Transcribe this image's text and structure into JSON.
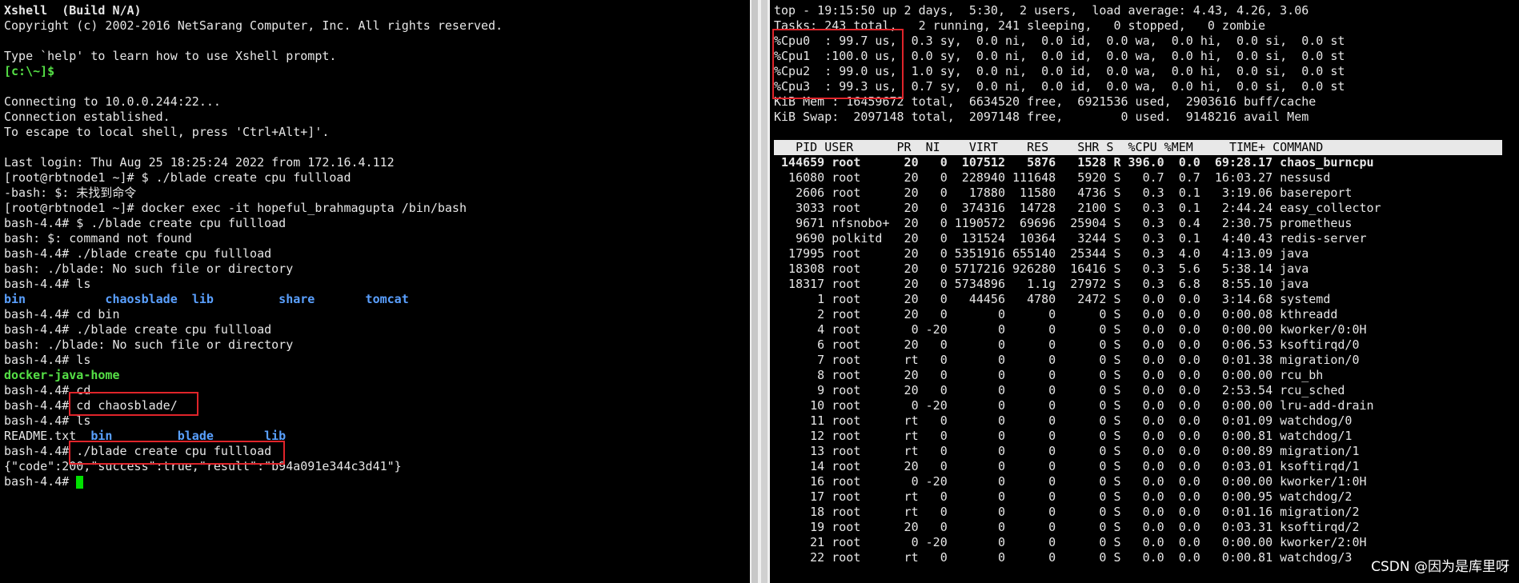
{
  "left_terminal": {
    "lines": [
      {
        "text": "Xshell  (Build N/A)",
        "style": "bold"
      },
      {
        "text": "Copyright (c) 2002-2016 NetSarang Computer, Inc. All rights reserved.",
        "style": ""
      },
      {
        "text": "",
        "style": ""
      },
      {
        "text": "Type `help' to learn how to use Xshell prompt.",
        "style": ""
      },
      {
        "text": "[c:\\~]$",
        "style": "green"
      },
      {
        "text": "",
        "style": ""
      },
      {
        "text": "Connecting to 10.0.0.244:22...",
        "style": ""
      },
      {
        "text": "Connection established.",
        "style": ""
      },
      {
        "text": "To escape to local shell, press 'Ctrl+Alt+]'.",
        "style": ""
      },
      {
        "text": "",
        "style": ""
      },
      {
        "text": "Last login: Thu Aug 25 18:25:24 2022 from 172.16.4.112",
        "style": ""
      },
      {
        "text": "[root@rbtnode1 ~]# $ ./blade create cpu fullload",
        "style": ""
      },
      {
        "text": "-bash: $: 未找到命令",
        "style": ""
      },
      {
        "text": "[root@rbtnode1 ~]# docker exec -it hopeful_brahmagupta /bin/bash",
        "style": ""
      },
      {
        "text": "bash-4.4# $ ./blade create cpu fullload",
        "style": ""
      },
      {
        "text": "bash: $: command not found",
        "style": ""
      },
      {
        "text": "bash-4.4# ./blade create cpu fullload",
        "style": ""
      },
      {
        "text": "bash: ./blade: No such file or directory",
        "style": ""
      },
      {
        "text": "bash-4.4# ls",
        "style": ""
      },
      {
        "text": "bin           chaosblade  lib         share       tomcat",
        "style": "blue"
      },
      {
        "text": "bash-4.4# cd bin",
        "style": ""
      },
      {
        "text": "bash-4.4# ./blade create cpu fullload",
        "style": ""
      },
      {
        "text": "bash: ./blade: No such file or directory",
        "style": ""
      },
      {
        "text": "bash-4.4# ls",
        "style": ""
      },
      {
        "text": "docker-java-home",
        "style": "green"
      },
      {
        "text": "bash-4.4# cd",
        "style": ""
      },
      {
        "text": "bash-4.4# cd chaosblade/",
        "style": ""
      },
      {
        "text": "bash-4.4# ls",
        "style": ""
      },
      {
        "text": "README.txt  bin         blade       lib",
        "style": "mixed"
      },
      {
        "text": "bash-4.4# ./blade create cpu fullload",
        "style": ""
      },
      {
        "text": "{\"code\":200,\"success\":true,\"result\":\"b94a091e344c3d41\"}",
        "style": ""
      },
      {
        "text": "bash-4.4# ",
        "style": "cursor"
      }
    ],
    "readme_label": "README.txt  ",
    "dir_labels": "bin         blade       lib"
  },
  "right_terminal": {
    "summary": [
      "top - 19:15:50 up 2 days,  5:30,  2 users,  load average: 4.43, 4.26, 3.06",
      "Tasks: 243 total,   2 running, 241 sleeping,   0 stopped,   0 zombie",
      "%Cpu0  : 99.7 us,  0.3 sy,  0.0 ni,  0.0 id,  0.0 wa,  0.0 hi,  0.0 si,  0.0 st",
      "%Cpu1  :100.0 us,  0.0 sy,  0.0 ni,  0.0 id,  0.0 wa,  0.0 hi,  0.0 si,  0.0 st",
      "%Cpu2  : 99.0 us,  1.0 sy,  0.0 ni,  0.0 id,  0.0 wa,  0.0 hi,  0.0 si,  0.0 st",
      "%Cpu3  : 99.3 us,  0.7 sy,  0.0 ni,  0.0 id,  0.0 wa,  0.0 hi,  0.0 si,  0.0 st",
      "KiB Mem : 16459672 total,  6634520 free,  6921536 used,  2903616 buff/cache",
      "KiB Swap:  2097148 total,  2097148 free,        0 used.  9148216 avail Mem",
      ""
    ],
    "header": "   PID USER      PR  NI    VIRT    RES    SHR S  %CPU %MEM     TIME+ COMMAND",
    "processes": [
      " 144659 root      20   0  107512   5876   1528 R 396.0  0.0  69:28.17 chaos_burncpu",
      "  16080 root      20   0  228940 111648   5920 S   0.7  0.7  16:03.27 nessusd",
      "   2606 root      20   0   17880  11580   4736 S   0.3  0.1   3:19.06 basereport",
      "   3033 root      20   0  374316  14728   2100 S   0.3  0.1   2:44.24 easy_collector",
      "   9671 nfsnobo+  20   0 1190572  69696  25904 S   0.3  0.4   2:30.75 prometheus",
      "   9690 polkitd   20   0  131524  10364   3244 S   0.3  0.1   4:40.43 redis-server",
      "  17995 root      20   0 5351916 655140  25344 S   0.3  4.0   4:13.09 java",
      "  18308 root      20   0 5717216 926280  16416 S   0.3  5.6   5:38.14 java",
      "  18317 root      20   0 5734896   1.1g  27972 S   0.3  6.8   8:55.10 java",
      "      1 root      20   0   44456   4780   2472 S   0.0  0.0   3:14.68 systemd",
      "      2 root      20   0       0      0      0 S   0.0  0.0   0:00.08 kthreadd",
      "      4 root       0 -20       0      0      0 S   0.0  0.0   0:00.00 kworker/0:0H",
      "      6 root      20   0       0      0      0 S   0.0  0.0   0:06.53 ksoftirqd/0",
      "      7 root      rt   0       0      0      0 S   0.0  0.0   0:01.38 migration/0",
      "      8 root      20   0       0      0      0 S   0.0  0.0   0:00.00 rcu_bh",
      "      9 root      20   0       0      0      0 S   0.0  0.0   2:53.54 rcu_sched",
      "     10 root       0 -20       0      0      0 S   0.0  0.0   0:00.00 lru-add-drain",
      "     11 root      rt   0       0      0      0 S   0.0  0.0   0:01.09 watchdog/0",
      "     12 root      rt   0       0      0      0 S   0.0  0.0   0:00.81 watchdog/1",
      "     13 root      rt   0       0      0      0 S   0.0  0.0   0:00.89 migration/1",
      "     14 root      20   0       0      0      0 S   0.0  0.0   0:03.01 ksoftirqd/1",
      "     16 root       0 -20       0      0      0 S   0.0  0.0   0:00.00 kworker/1:0H",
      "     17 root      rt   0       0      0      0 S   0.0  0.0   0:00.95 watchdog/2",
      "     18 root      rt   0       0      0      0 S   0.0  0.0   0:01.16 migration/2",
      "     19 root      20   0       0      0      0 S   0.0  0.0   0:03.31 ksoftirqd/2",
      "     21 root       0 -20       0      0      0 S   0.0  0.0   0:00.00 kworker/2:0H",
      "     22 root      rt   0       0      0      0 S   0.0  0.0   0:00.81 watchdog/3"
    ]
  },
  "watermark": "CSDN @因为是库里呀",
  "colors": {
    "background": "#000000",
    "text": "#e6e6e6",
    "green": "#55e046",
    "blue": "#5aa0ff",
    "highlight_box": "#e0242a",
    "cursor": "#00e000"
  }
}
